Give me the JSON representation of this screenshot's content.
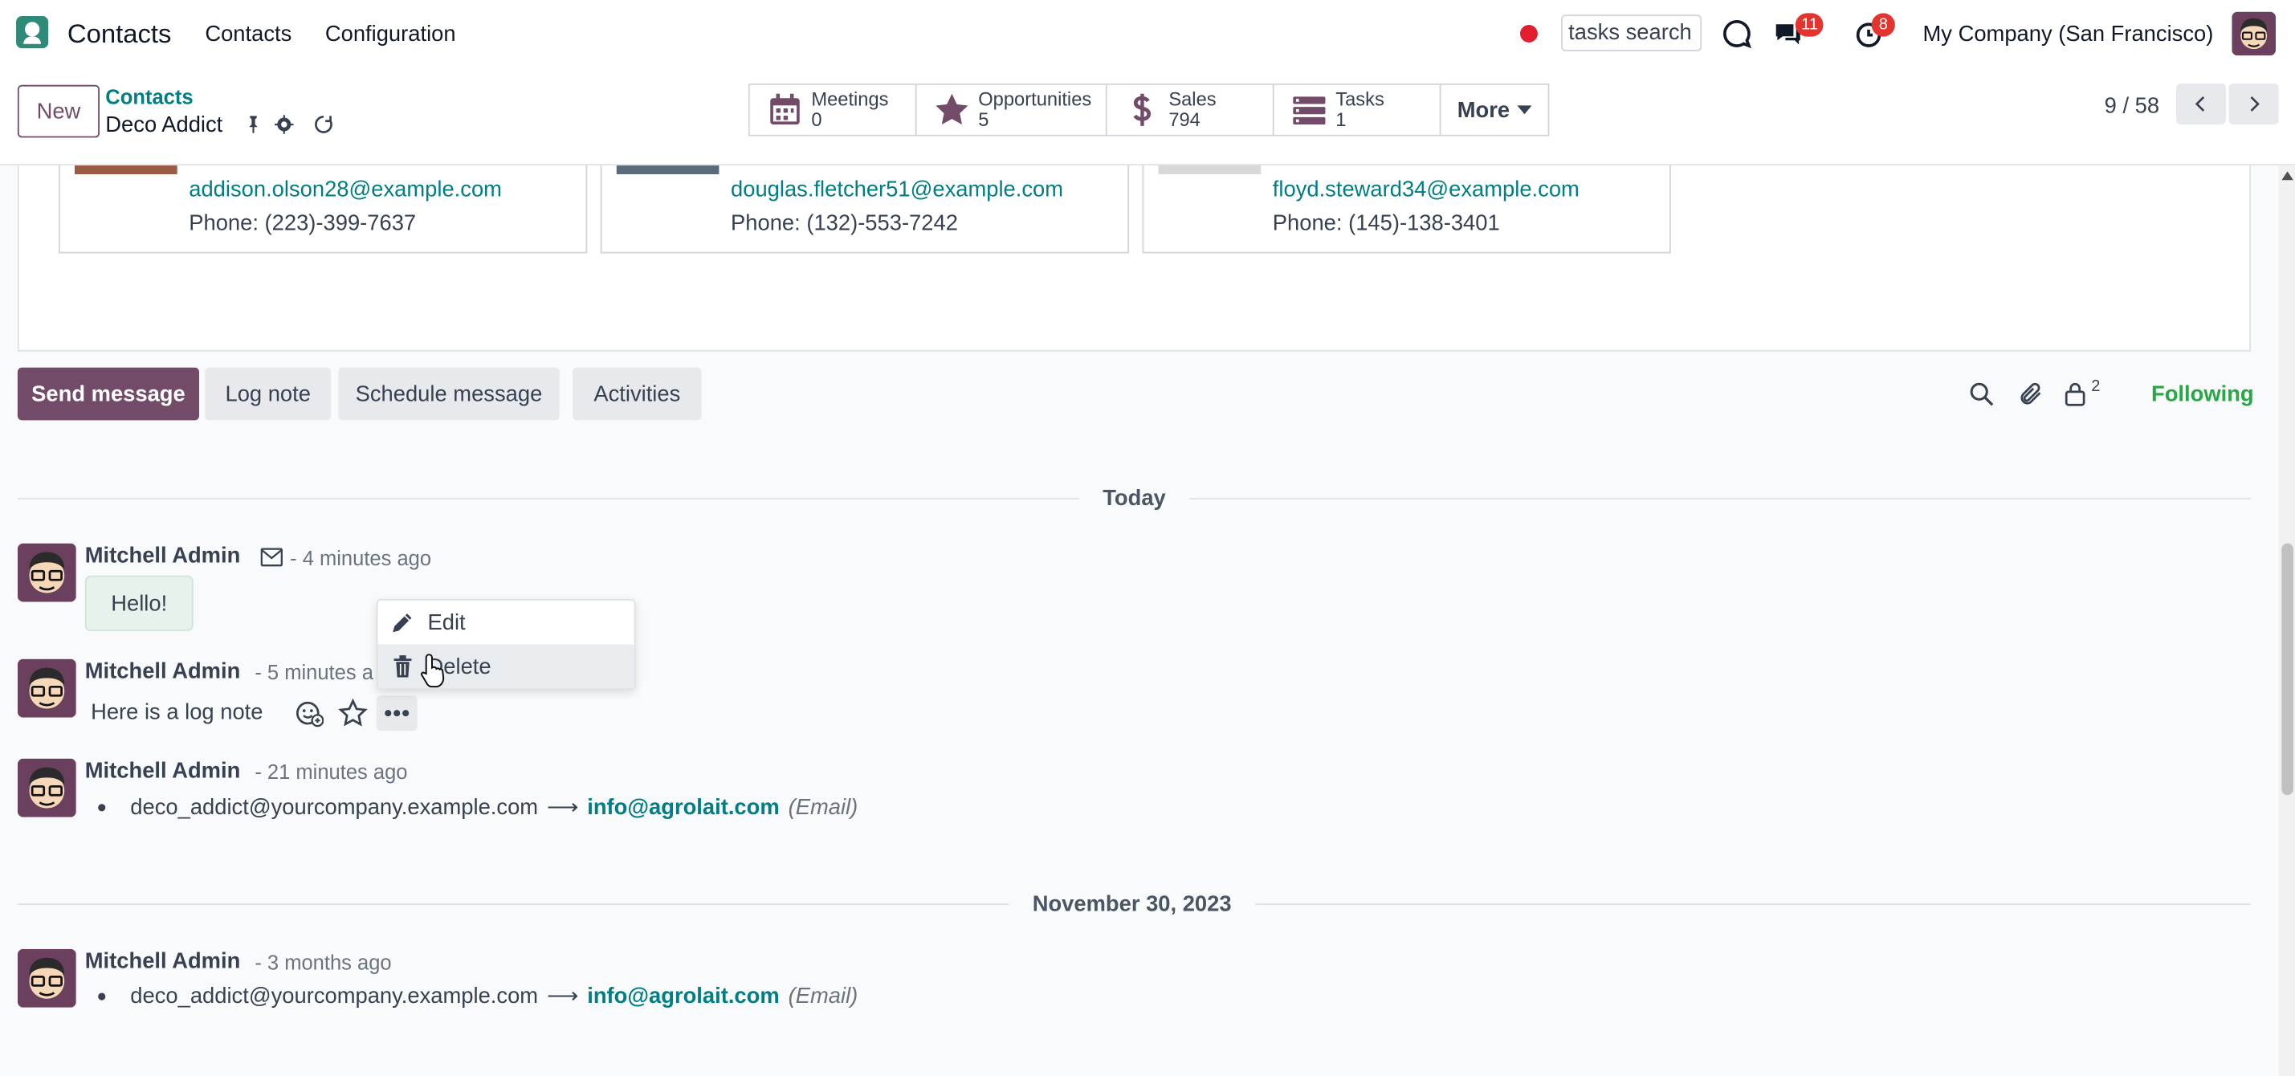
{
  "navbar": {
    "app_name": "Contacts",
    "menu": [
      "Contacts",
      "Configuration"
    ],
    "search_value": "tasks search",
    "messages_count": "11",
    "activities_count": "8",
    "company": "My Company (San Francisco)"
  },
  "control_panel": {
    "new_label": "New",
    "breadcrumb_parent": "Contacts",
    "record_name": "Deco Addict",
    "smart_buttons": [
      {
        "label": "Meetings",
        "value": "0",
        "icon": "calendar-icon"
      },
      {
        "label": "Opportunities",
        "value": "5",
        "icon": "star-icon"
      },
      {
        "label": "Sales",
        "value": "794",
        "icon": "dollar-icon"
      },
      {
        "label": "Tasks",
        "value": "1",
        "icon": "tasks-icon"
      }
    ],
    "more_label": "More",
    "pager": "9 / 58"
  },
  "contacts": [
    {
      "email": "addison.olson28@example.com",
      "phone": "Phone: (223)-399-7637"
    },
    {
      "email": "douglas.fletcher51@example.com",
      "phone": "Phone: (132)-553-7242"
    },
    {
      "email": "floyd.steward34@example.com",
      "phone": "Phone: (145)-138-3401"
    }
  ],
  "chatter": {
    "send_message": "Send message",
    "log_note": "Log note",
    "schedule_message": "Schedule message",
    "activities": "Activities",
    "followers_count": "2",
    "following": "Following",
    "separators": [
      "Today",
      "November 30, 2023"
    ],
    "messages": [
      {
        "author": "Mitchell Admin",
        "time": "- 4 minutes ago",
        "body": "Hello!"
      },
      {
        "author": "Mitchell Admin",
        "time": "- 5 minutes a",
        "body": "Here is a log note"
      },
      {
        "author": "Mitchell Admin",
        "time": "- 21 minutes ago",
        "tracking_old": "deco_addict@yourcompany.example.com",
        "tracking_new": "info@agrolait.com",
        "tracking_field": "(Email)"
      },
      {
        "author": "Mitchell Admin",
        "time": "- 3 months ago",
        "tracking_old": "deco_addict@yourcompany.example.com",
        "tracking_new": "info@agrolait.com",
        "tracking_field": "(Email)"
      }
    ],
    "dropdown": {
      "edit": "Edit",
      "delete": "Delete"
    }
  },
  "colors": {
    "primary": "#714b67",
    "link": "#017e84",
    "following": "#28a745",
    "badge": "#e4342f"
  }
}
